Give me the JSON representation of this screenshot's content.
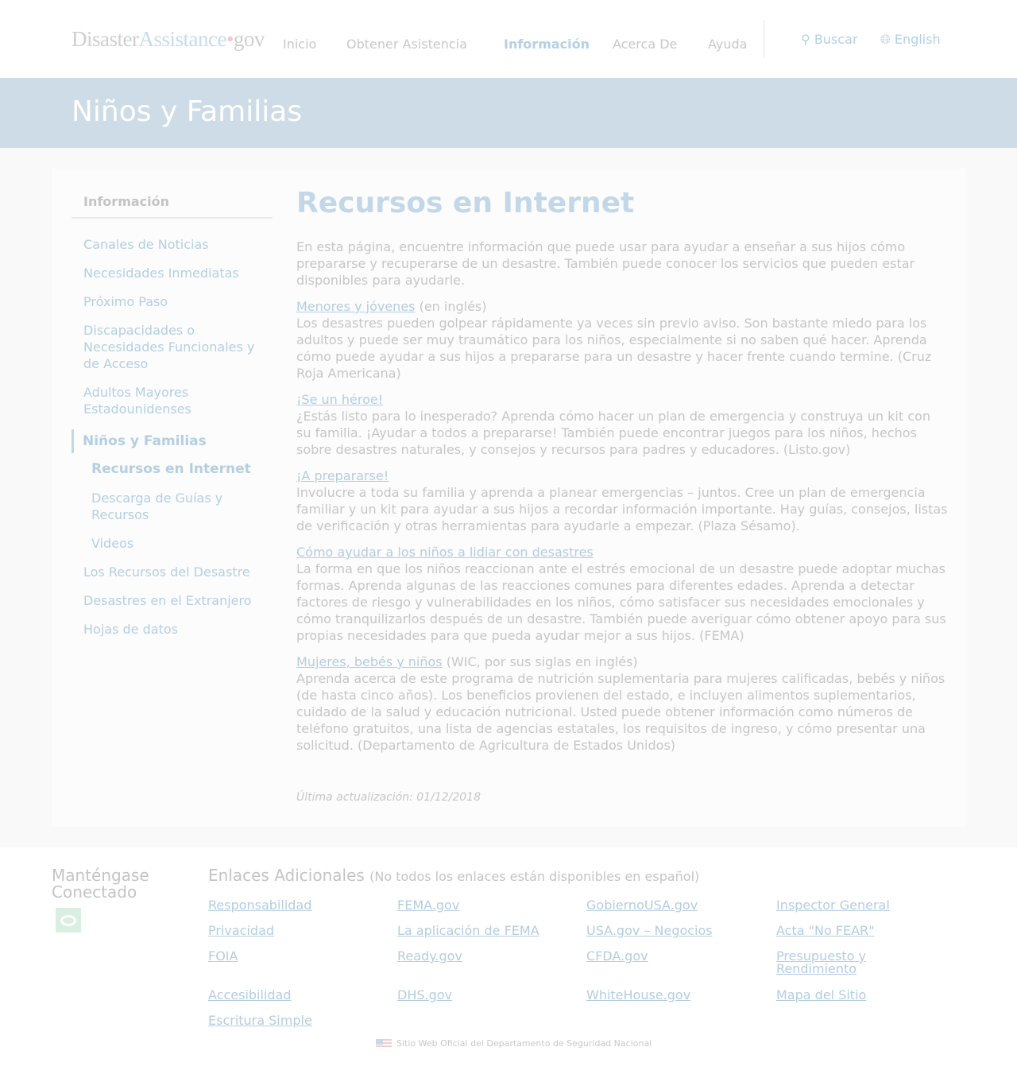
{
  "header": {
    "logo_part1": "Disaster",
    "logo_part2": "Assistance",
    "logo_dot": "•",
    "logo_part3": "gov",
    "nav": [
      "Inicio",
      "Obtener Asistencia",
      "Información",
      "Acerca De",
      "Ayuda"
    ],
    "search": "Buscar",
    "language": "English"
  },
  "banner": {
    "title": "Niños y Familias"
  },
  "sidebar": {
    "heading": "Información",
    "items": [
      "Canales de Noticias",
      "Necesidades Inmediatas",
      "Próximo Paso",
      "Discapacidades o Necesidades Funcionales y de Acceso",
      "Adultos Mayores Estadounidenses",
      "Niños y Familias",
      "Recursos en Internet",
      "Descarga de Guías y Recursos",
      "Videos",
      "Los Recursos del Desastre",
      "Desastres en el Extranjero",
      "Hojas de datos"
    ]
  },
  "main": {
    "title": "Recursos en Internet",
    "intro": "En esta página, encuentre información que puede usar para ayudar a enseñar a sus hijos cómo prepararse y recuperarse de un desastre. También puede conocer los servicios que pueden estar disponibles para ayudarle.",
    "resources": [
      {
        "link": "Menores y jóvenes",
        "note": " (en inglés)",
        "text": "Los desastres pueden golpear rápidamente ya veces sin previo aviso. Son bastante miedo para los adultos y puede ser muy traumático para los niños, especialmente si no saben qué hacer. Aprenda cómo puede ayudar a sus hijos a prepararse para un desastre y hacer frente cuando termine. (Cruz Roja Americana)"
      },
      {
        "link": "¡Se un héroe!",
        "note": "",
        "text": "¿Estás listo para lo inesperado? Aprenda cómo hacer un plan de emergencia y construya un kit con su familia. ¡Ayudar a todos a prepararse! También puede encontrar juegos para los niños, hechos sobre desastres naturales, y consejos y recursos para padres y educadores. (Listo.gov)"
      },
      {
        "link": "¡A prepararse!",
        "note": "",
        "text": "Involucre a toda su familia y aprenda a planear emergencias – juntos. Cree un plan de emergencia familiar y un kit para ayudar a sus hijos a recordar información importante. Hay guías, consejos, listas de verificación y otras herramientas para ayudarle a empezar. (Plaza Sésamo)."
      },
      {
        "link": "Cómo ayudar a los niños a lidiar con desastres",
        "note": "",
        "text": "La forma en que los niños reaccionan ante el estrés emocional de un desastre puede adoptar muchas formas. Aprenda algunas de las reacciones comunes para diferentes edades. Aprenda a detectar factores de riesgo y vulnerabilidades en los niños, cómo satisfacer sus necesidades emocionales y cómo tranquilizarlos después de un desastre. También puede averiguar cómo obtener apoyo para sus propias necesidades para que pueda ayudar mejor a sus hijos. (FEMA)"
      },
      {
        "link": "Mujeres, bebés y niños",
        "note": " (WIC, por sus siglas en inglés)",
        "text": "Aprenda acerca de este programa de nutrición suplementaria para mujeres calificadas, bebés y niños (de hasta cinco años). Los beneficios provienen del estado, e incluyen alimentos suplementarios, cuidado de la salud y educación nutricional. Usted puede obtener información como números de teléfono gratuitos, una lista de agencias estatales, los requisitos de ingreso, y cómo presentar una solicitud. (Departamento de Agricultura de Estados Unidos)"
      }
    ],
    "updated": "Última actualización: 01/12/2018"
  },
  "footer": {
    "connected": "Manténgase Conectado",
    "links_title": "Enlaces Adicionales",
    "links_note": "(No todos los enlaces están disponibles en español)",
    "columns": [
      [
        "Responsabilidad",
        "Privacidad",
        "FOIA",
        "Accesibilidad",
        "Escritura Simple"
      ],
      [
        "FEMA.gov",
        "La aplicación de FEMA",
        "Ready.gov",
        "DHS.gov"
      ],
      [
        "GobiernoUSA.gov",
        "USA.gov – Negocios",
        "CFDA.gov",
        "WhiteHouse.gov"
      ],
      [
        "Inspector General",
        "Acta \"No FEAR\"",
        "Presupuesto y Rendimiento",
        "Mapa del Sitio"
      ]
    ],
    "official": "Sitio Web Oficial del Departamento de Seguridad Nacional"
  }
}
